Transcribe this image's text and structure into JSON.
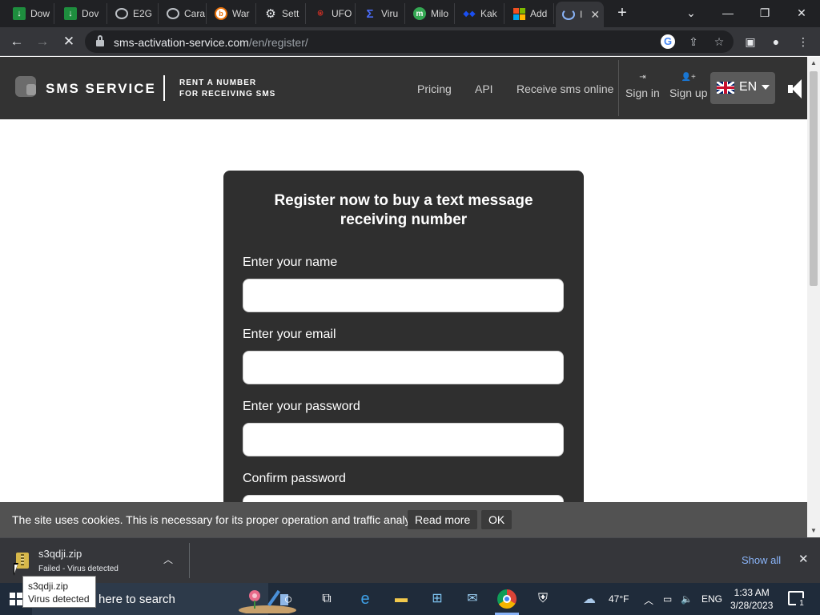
{
  "browser": {
    "tabs": [
      {
        "label": "Dow",
        "icon": "download-icon"
      },
      {
        "label": "Dov",
        "icon": "download-icon"
      },
      {
        "label": "E2G",
        "icon": "globe-icon"
      },
      {
        "label": "Cara",
        "icon": "globe-icon"
      },
      {
        "label": "War",
        "icon": "war-icon"
      },
      {
        "label": "Sett",
        "icon": "gear-icon"
      },
      {
        "label": "UFO",
        "icon": "ufo-icon"
      },
      {
        "label": "Viru",
        "icon": "virus-icon"
      },
      {
        "label": "Milo",
        "icon": "milo-icon"
      },
      {
        "label": "Kak",
        "icon": "kak-icon"
      },
      {
        "label": "Add",
        "icon": "microsoft-icon"
      },
      {
        "label": "I",
        "icon": "loading-icon",
        "active": true
      }
    ],
    "url_host": "sms-activation-service.com",
    "url_path": "/en/register/"
  },
  "site": {
    "brand": "SMS SERVICE",
    "tagline_line1": "RENT A NUMBER",
    "tagline_line2": "FOR RECEIVING SMS",
    "nav": [
      "Pricing",
      "API",
      "Receive sms online"
    ],
    "sign_in": "Sign in",
    "sign_up": "Sign up",
    "language": "EN"
  },
  "register": {
    "title": "Register now to buy a text message receiving number",
    "name_label": "Enter your name",
    "email_label": "Enter your email",
    "password_label": "Enter your password",
    "confirm_label": "Confirm password",
    "name_value": "",
    "email_value": "",
    "password_value": "",
    "confirm_value": ""
  },
  "cookie": {
    "text": "The site uses cookies. This is necessary for its proper operation and traffic analysis.",
    "read_more": "Read more",
    "ok": "OK"
  },
  "downloads": {
    "file_name": "s3qdji.zip",
    "status": "Failed - Virus detected",
    "show_all": "Show all"
  },
  "tooltip": {
    "line1": "s3qdji.zip",
    "line2": "Virus detected"
  },
  "taskbar": {
    "search_text": "here to search",
    "temperature": "47°F",
    "language": "ENG",
    "time": "1:33 AM",
    "date": "3/28/2023",
    "notification_count": "1"
  },
  "colors": {
    "header_bg": "#333333",
    "card_bg": "#2f2f2f",
    "cookie_bg": "#525252",
    "link_blue": "#8ab4f8"
  }
}
